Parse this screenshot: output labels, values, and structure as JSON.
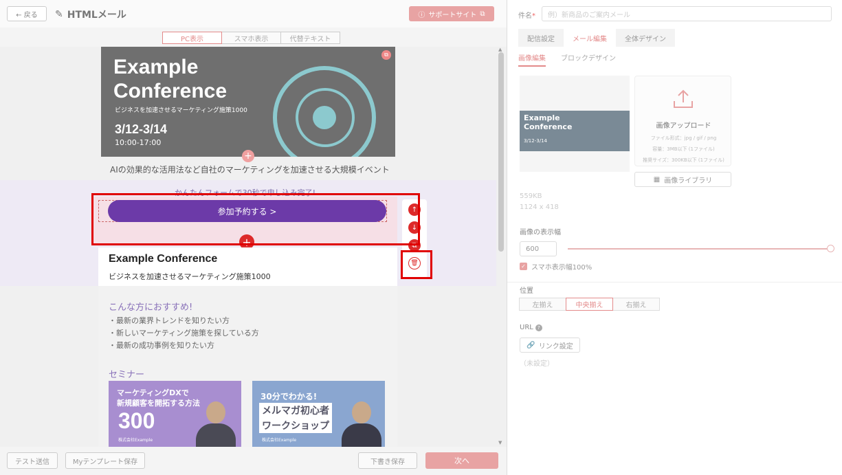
{
  "header": {
    "back_label": "← 戻る",
    "title": "HTMLメール",
    "support_label": "サポートサイト"
  },
  "view_tabs": [
    "PC表示",
    "スマホ表示",
    "代替テキスト"
  ],
  "banner": {
    "title": "Example\nConference",
    "subtitle": "ビジネスを加速させるマーケティング施策1000",
    "date": "3/12-3/14",
    "time": "10:00-17:00"
  },
  "tagline": "AIの効果的な活用法など自社のマーケティングを加速させる大規模イベント",
  "form_note": "かんたんフォームで30秒で申し込み完了!",
  "join_button": "参加予約する >",
  "conference": {
    "title": "Example Conference",
    "subtitle": "ビジネスを加速させるマーケティング施策1000"
  },
  "recommend": {
    "title": "こんな方におすすめ!",
    "items": [
      "・最新の業界トレンドを知りたい方",
      "・新しいマーケティング施策を探している方",
      "・最新の成功事例を知りたい方"
    ]
  },
  "seminar": {
    "title": "セミナー",
    "card1_line1": "マーケティングDXで",
    "card1_line2": "新規顧客を開拓する方法",
    "card1_num": "300",
    "card1_company": "株式会社Example",
    "card2_line1": "30分でわかる!",
    "card2_line2": "メルマガ初心者",
    "card2_line3": "ワークショップ",
    "card2_company": "株式会社Example"
  },
  "footer": {
    "test_send": "テスト送信",
    "save_template": "Myテンプレート保存",
    "save_draft": "下書き保存",
    "next": "次へ"
  },
  "right": {
    "subject_label": "件名",
    "subject_required": "*",
    "subject_placeholder": "例）新商品のご案内メール",
    "tabs": [
      "配信設定",
      "メール編集",
      "全体デザイン"
    ],
    "subtabs": [
      "画像編集",
      "ブロックデザイン"
    ],
    "preview_title": "Example\nConference",
    "preview_date": "3/12-3/14",
    "upload_title": "画像アップロード",
    "upload_info": [
      "ファイル形式：jpg / gif / png",
      "容量：3MB以下 (1ファイル)",
      "推奨サイズ：300KB以下 (1ファイル)"
    ],
    "library_label": "画像ライブラリ",
    "file_size": "559KB",
    "file_dims": "1124 x 418",
    "display_width_label": "画像の表示幅",
    "display_width_value": "600",
    "display_width_fraction": 1.0,
    "mobile_full_width_label": "スマホ表示幅100%",
    "mobile_full_width_checked": true,
    "position_label": "位置",
    "align_options": [
      "左揃え",
      "中央揃え",
      "右揃え"
    ],
    "align_selected": "中央揃え",
    "url_label": "URL",
    "link_label": "リンク設定",
    "link_status": "（未設定）"
  },
  "colors": {
    "accent": "#e38a8a",
    "join_button": "#6c3aa8",
    "highlight": "#e00000"
  }
}
